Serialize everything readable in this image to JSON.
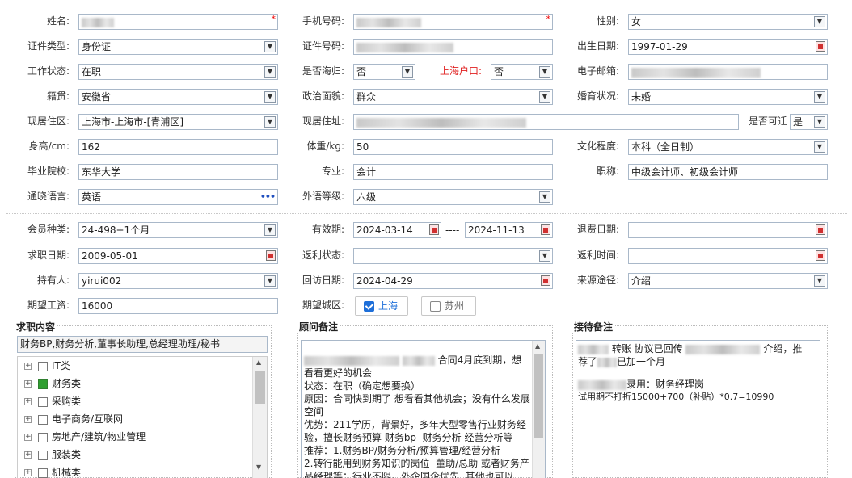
{
  "personal": {
    "name_label": "姓名:",
    "phone_label": "手机号码:",
    "gender_label": "性别:",
    "gender_value": "女",
    "id_type_label": "证件类型:",
    "id_type_value": "身份证",
    "id_number_label": "证件号码:",
    "birth_label": "出生日期:",
    "birth_value": "1997-01-29",
    "work_status_label": "工作状态:",
    "work_status_value": "在职",
    "overseas_label": "是否海归:",
    "overseas_value": "否",
    "shanghai_hukou_label": "上海户口:",
    "shanghai_hukou_value": "否",
    "email_label": "电子邮箱:",
    "native_label": "籍贯:",
    "native_value": "安徽省",
    "political_label": "政治面貌:",
    "political_value": "群众",
    "marital_label": "婚育状况:",
    "marital_value": "未婚",
    "residence_area_label": "现居住区:",
    "residence_area_value": "上海市-上海市-[青浦区]",
    "address_label": "现居住址:",
    "relocate_label": "是否可迁",
    "relocate_value": "是",
    "height_label": "身高/cm:",
    "height_value": "162",
    "weight_label": "体重/kg:",
    "weight_value": "50",
    "education_label": "文化程度:",
    "education_value": "本科（全日制）",
    "school_label": "毕业院校:",
    "school_value": "东华大学",
    "major_label": "专业:",
    "major_value": "会计",
    "title_label": "职称:",
    "title_value": "中级会计师、初级会计师",
    "language_label": "通晓语言:",
    "language_value": "英语",
    "foreign_level_label": "外语等级:",
    "foreign_level_value": "六级"
  },
  "membership": {
    "member_type_label": "会员种类:",
    "member_type_value": "24-498+1个月",
    "valid_label": "有效期:",
    "valid_from": "2024-03-14",
    "valid_sep": "----",
    "valid_to": "2024-11-13",
    "refund_label": "退费日期:",
    "job_date_label": "求职日期:",
    "job_date_value": "2009-05-01",
    "rebate_status_label": "返利状态:",
    "rebate_time_label": "返利时间:",
    "holder_label": "持有人:",
    "holder_value": "yirui002",
    "visit_label": "回访日期:",
    "visit_value": "2024-04-29",
    "source_label": "来源途径:",
    "source_value": "介绍",
    "salary_label": "期望工资:",
    "salary_value": "16000",
    "city_label": "期望城区:",
    "city_shanghai": "上海",
    "city_suzhou": "苏州"
  },
  "job_panel": {
    "title": "求职内容",
    "summary": "财务BP,财务分析,董事长助理,总经理助理/秘书",
    "tree": [
      {
        "label": "IT类",
        "checked": false
      },
      {
        "label": "财务类",
        "checked": true
      },
      {
        "label": "采购类",
        "checked": false
      },
      {
        "label": "电子商务/互联网",
        "checked": false
      },
      {
        "label": "房地产/建筑/物业管理",
        "checked": false
      },
      {
        "label": "服装类",
        "checked": false
      },
      {
        "label": "机械类",
        "checked": false
      }
    ]
  },
  "consultant_panel": {
    "title": "顾问备注",
    "line1_tail": "合同4月底到期，想",
    "body": "看看更好的机会\n状态：在职（确定想要换）\n原因：合同快到期了 想看看其他机会；没有什么发展空间\n优势：211学历，背景好，多年大型零售行业财务经验，擅长财务预算 财务bp  财务分析 经营分析等\n推荐：1.财务BP/财务分析/预算管理/经营分析\n2.转行能用到财务知识的岗位  董助/总助 或者财务产品经理等；行业不限，外企国企优先  其他也可以"
  },
  "reception_panel": {
    "title": "接待备注",
    "line1_mid": "转账 协议已回传",
    "line1_tail": "介绍，推",
    "line2_head": "荐了",
    "line2_tail": "已加一个月",
    "line3_tail": "录用：财务经理岗",
    "line4": "试用期不打折15000+700（补贴）*0.7=10990"
  }
}
